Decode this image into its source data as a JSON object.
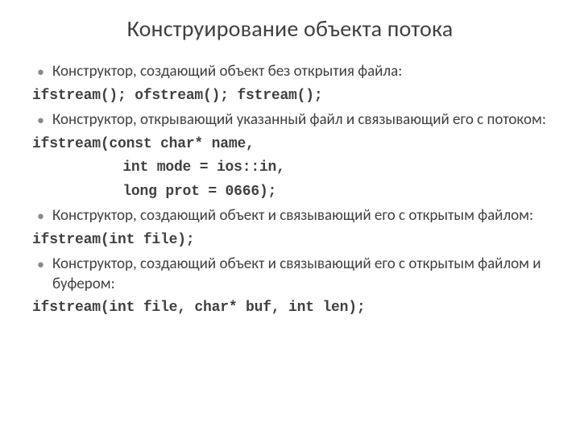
{
  "title": "Конструирование объекта потока",
  "items": {
    "b1": "Конструктор, создающий объект без открытия файла:",
    "c1": "ifstream(); ofstream(); fstream();",
    "b2": "Конструктор, открывающий указанный файл и связывающий его с потоком:",
    "c2a": "ifstream(const char* name,",
    "c2b": "int mode = ios::in,",
    "c2c": "long prot = 0666);",
    "b3": "Конструктор, создающий объект и связывающий его с открытым файлом:",
    "c3": "ifstream(int file);",
    "b4": "Конструктор, создающий объект и связывающий его с открытым файлом и буфером:",
    "c4": "ifstream(int file, char* buf, int len);"
  }
}
